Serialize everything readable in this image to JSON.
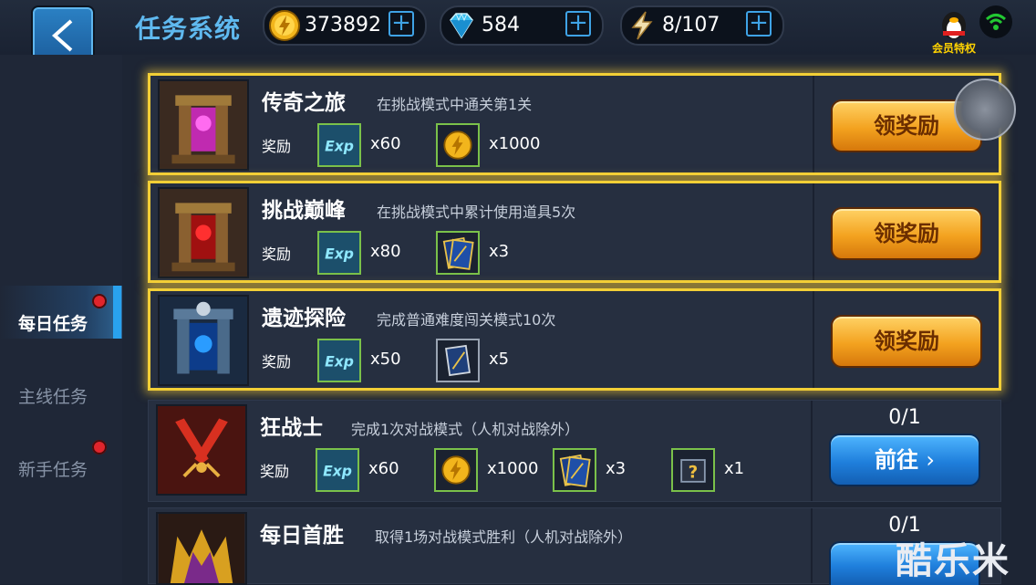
{
  "header": {
    "title": "任务系统",
    "gold": "373892",
    "gems": "584",
    "energy": "8/107",
    "vip_label": "会员特权"
  },
  "sidebar": {
    "items": [
      {
        "label": "每日任务",
        "active": true,
        "dot": true
      },
      {
        "label": "主线任务",
        "active": false,
        "dot": false
      },
      {
        "label": "新手任务",
        "active": false,
        "dot": true
      }
    ]
  },
  "tasks": [
    {
      "name": "传奇之旅",
      "desc": "在挑战模式中通关第1关",
      "reward_label": "奖励",
      "rewards": [
        {
          "icon": "exp-icon",
          "qty": "x60"
        },
        {
          "icon": "gold-coin-icon",
          "qty": "x1000"
        }
      ],
      "button": "领奖励"
    },
    {
      "name": "挑战巅峰",
      "desc": "在挑战模式中累计使用道具5次",
      "reward_label": "奖励",
      "rewards": [
        {
          "icon": "exp-icon",
          "qty": "x80"
        },
        {
          "icon": "exp-card-icon",
          "qty": "x3"
        }
      ],
      "button": "领奖励"
    },
    {
      "name": "遗迹探险",
      "desc": "完成普通难度闯关模式10次",
      "reward_label": "奖励",
      "rewards": [
        {
          "icon": "exp-icon",
          "qty": "x50"
        },
        {
          "icon": "exp-card-icon",
          "qty": "x5"
        }
      ],
      "button": "领奖励"
    },
    {
      "name": "狂战士",
      "desc": "完成1次对战模式（人机对战除外）",
      "reward_label": "奖励",
      "progress": "0/1",
      "rewards": [
        {
          "icon": "exp-icon",
          "qty": "x60"
        },
        {
          "icon": "gold-coin-icon",
          "qty": "x1000"
        },
        {
          "icon": "exp-card-icon",
          "qty": "x3"
        },
        {
          "icon": "mystery-box-icon",
          "qty": "x1"
        }
      ],
      "button": "前往"
    },
    {
      "name": "每日首胜",
      "desc": "取得1场对战模式胜利（人机对战除外）",
      "progress": "0/1"
    }
  ],
  "watermark": "酷乐米"
}
